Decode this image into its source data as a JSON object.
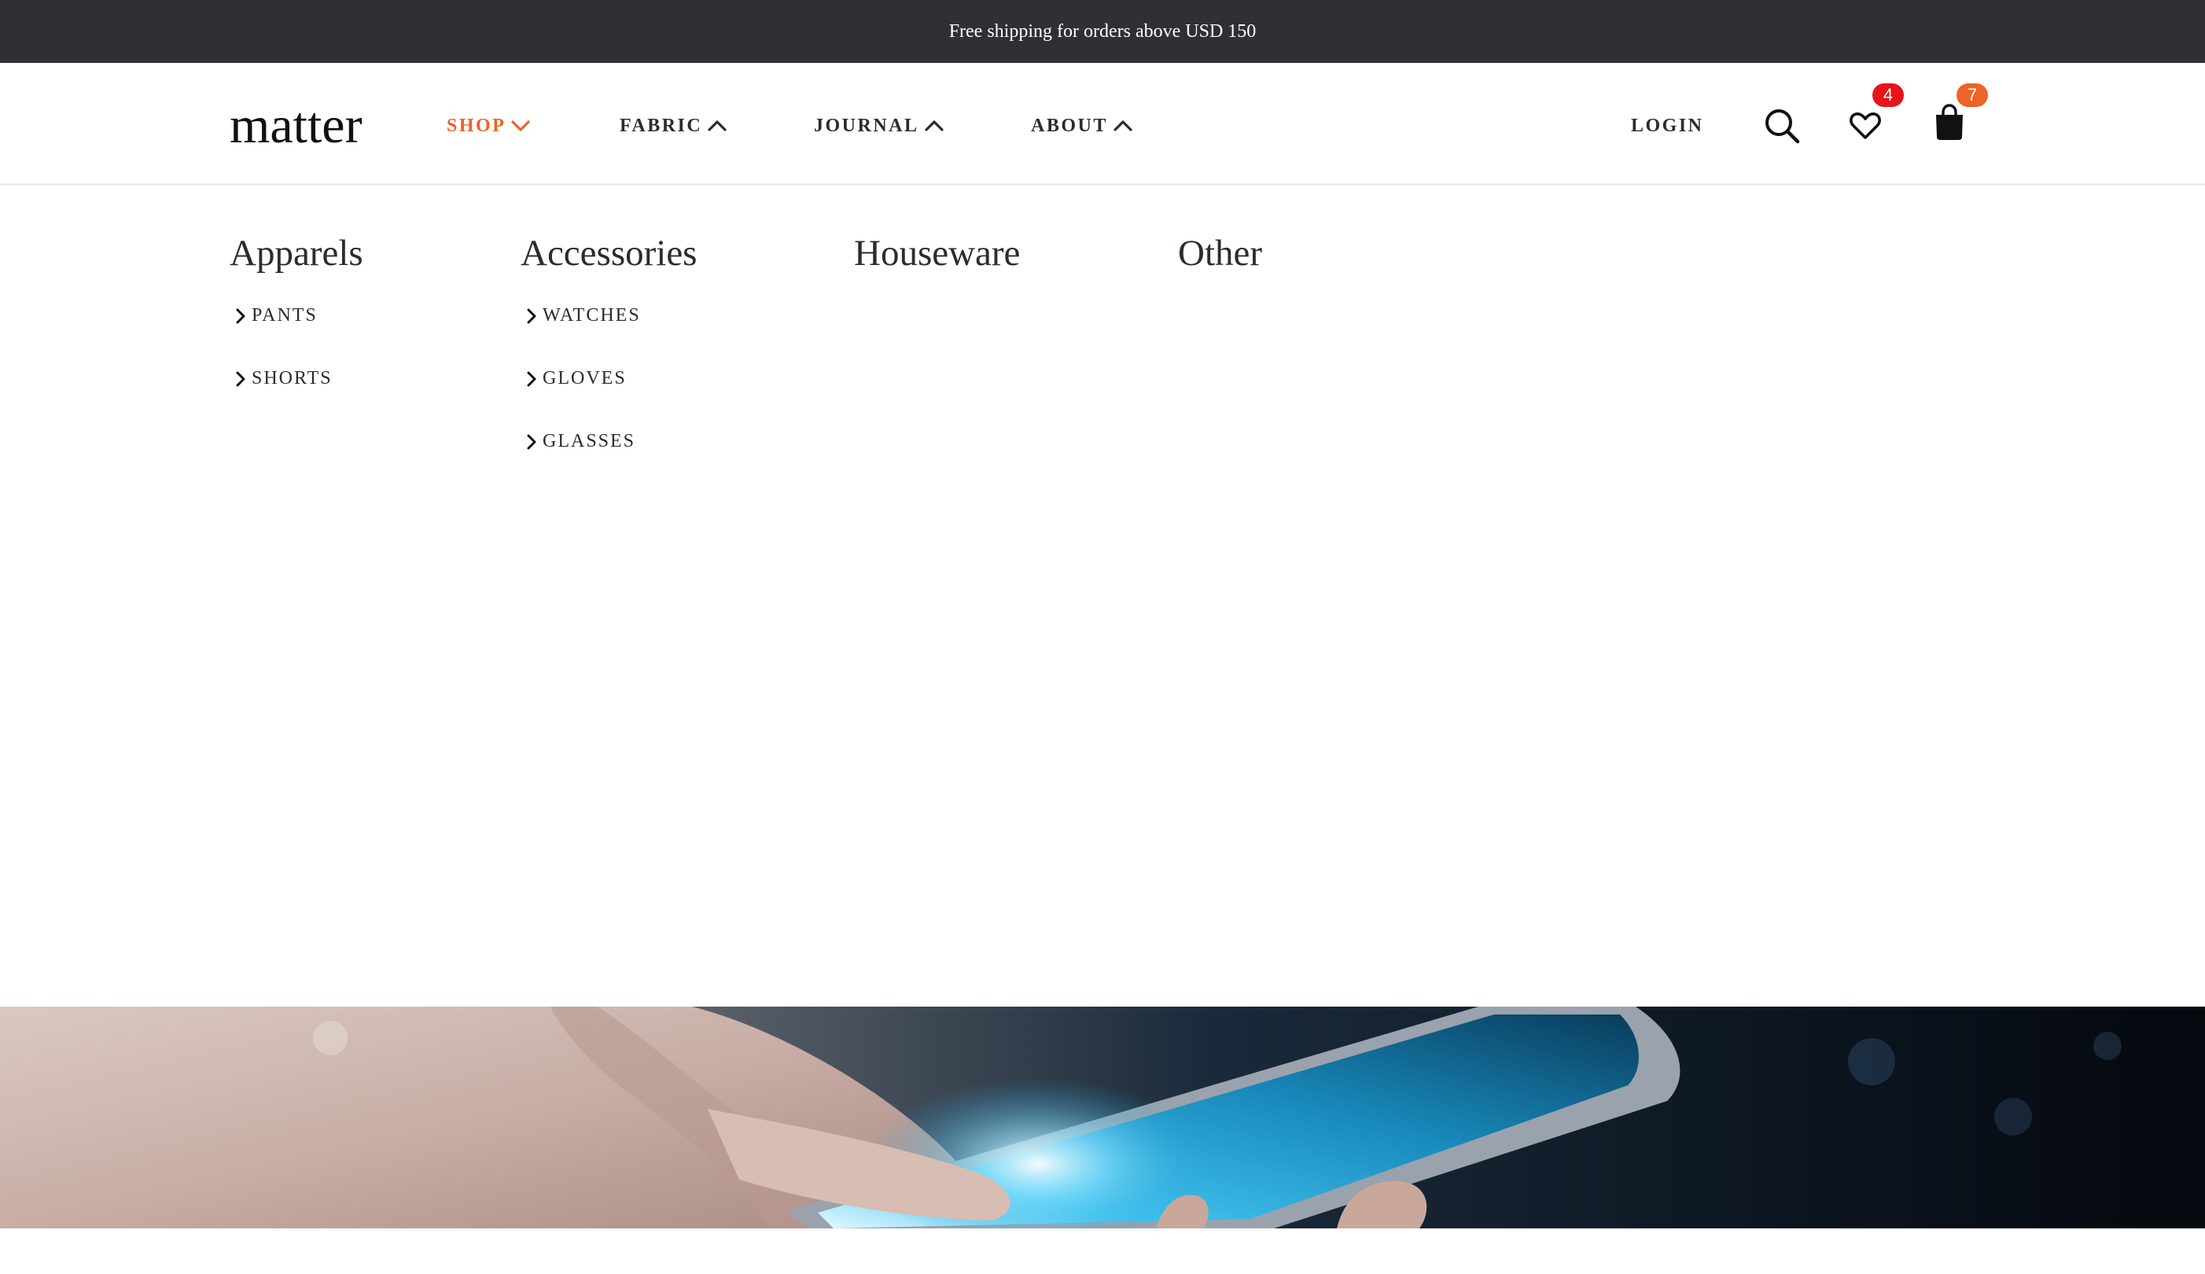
{
  "announcement": {
    "text": "Free shipping for orders above USD 150"
  },
  "header": {
    "logo": "matter",
    "nav": [
      {
        "label": "SHOP",
        "chevron": "chevron-down-icon",
        "active": true
      },
      {
        "label": "FABRIC",
        "chevron": "chevron-up-icon",
        "active": false
      },
      {
        "label": "JOURNAL",
        "chevron": "chevron-up-icon",
        "active": false
      },
      {
        "label": "ABOUT",
        "chevron": "chevron-up-icon",
        "active": false
      }
    ],
    "login_label": "LOGIN",
    "search_icon": "search-icon",
    "wishlist": {
      "icon": "heart-icon",
      "count": "4",
      "badge_color": "#e8131b"
    },
    "cart": {
      "icon": "shopping-bag-icon",
      "count": "7",
      "badge_color": "#ee6326"
    }
  },
  "mega_menu": {
    "columns": [
      {
        "title": "Apparels",
        "items": [
          "PANTS",
          "SHORTS"
        ]
      },
      {
        "title": "Accessories",
        "items": [
          "WATCHES",
          "GLOVES",
          "GLASSES"
        ]
      },
      {
        "title": "Houseware",
        "items": []
      },
      {
        "title": "Other",
        "items": []
      }
    ]
  },
  "colors": {
    "accent": "#ee6326",
    "topbar": "#2f3036",
    "text": "#2a2b33"
  }
}
